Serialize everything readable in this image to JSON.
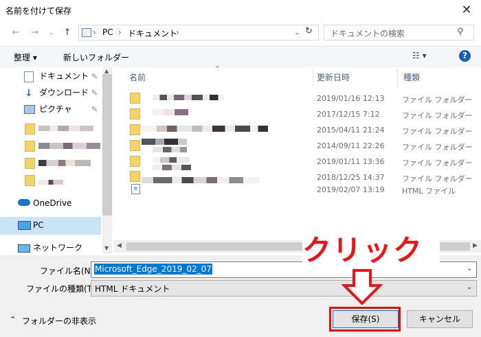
{
  "window": {
    "title": "名前を付けて保存",
    "close_glyph": "✕"
  },
  "nav": {
    "back": "←",
    "forward": "→",
    "recent": "⌄",
    "up": "↑",
    "breadcrumb": [
      "PC",
      "ドキュメント"
    ],
    "sep": "›",
    "search_placeholder": "ドキュメントの検索"
  },
  "toolbar": {
    "organize_label": "整理 ▾",
    "new_folder_label": "新しいフォルダー",
    "view_glyph": "☷ ▾",
    "help_glyph": "?"
  },
  "navpane": {
    "quick": [
      {
        "label": "ドキュメント",
        "pinned": true
      },
      {
        "label": "ダウンロード",
        "pinned": true
      },
      {
        "label": "ピクチャ",
        "pinned": true
      }
    ],
    "onedrive": "OneDrive",
    "pc": "PC",
    "network": "ネットワーク",
    "pin_glyph": "📌"
  },
  "filelist": {
    "headers": {
      "name": "名前",
      "date": "更新日時",
      "type": "種類"
    },
    "sort_indicator": "⌃",
    "rows": [
      {
        "date": "2019/01/16 12:13",
        "type": "ファイル フォルダー",
        "kind": "folder"
      },
      {
        "date": "2017/12/15 7:12",
        "type": "ファイル フォルダー",
        "kind": "folder"
      },
      {
        "date": "2015/04/11 21:24",
        "type": "ファイル フォルダー",
        "kind": "folder"
      },
      {
        "date": "2014/09/11 22:26",
        "type": "ファイル フォルダー",
        "kind": "folder"
      },
      {
        "date": "2019/01/11 13:36",
        "type": "ファイル フォルダー",
        "kind": "folder"
      },
      {
        "date": "2018/12/25 14:37",
        "type": "ファイル フォルダー",
        "kind": "folder"
      },
      {
        "date": "2019/02/07 13:19",
        "type": "HTML ファイル",
        "kind": "html"
      }
    ]
  },
  "form": {
    "filename_label": "ファイル名(N):",
    "filename_value": "Microsoft_Edge_2019_02_07",
    "filetype_label": "ファイルの種類(T):",
    "filetype_value": "HTML ドキュメント"
  },
  "footer": {
    "hide_folders": "フォルダーの非表示",
    "hide_glyph": "⌃",
    "save_label": "保存(S)",
    "cancel_label": "キャンセル"
  },
  "annotation": {
    "text": "クリック",
    "color": "#e81616"
  }
}
